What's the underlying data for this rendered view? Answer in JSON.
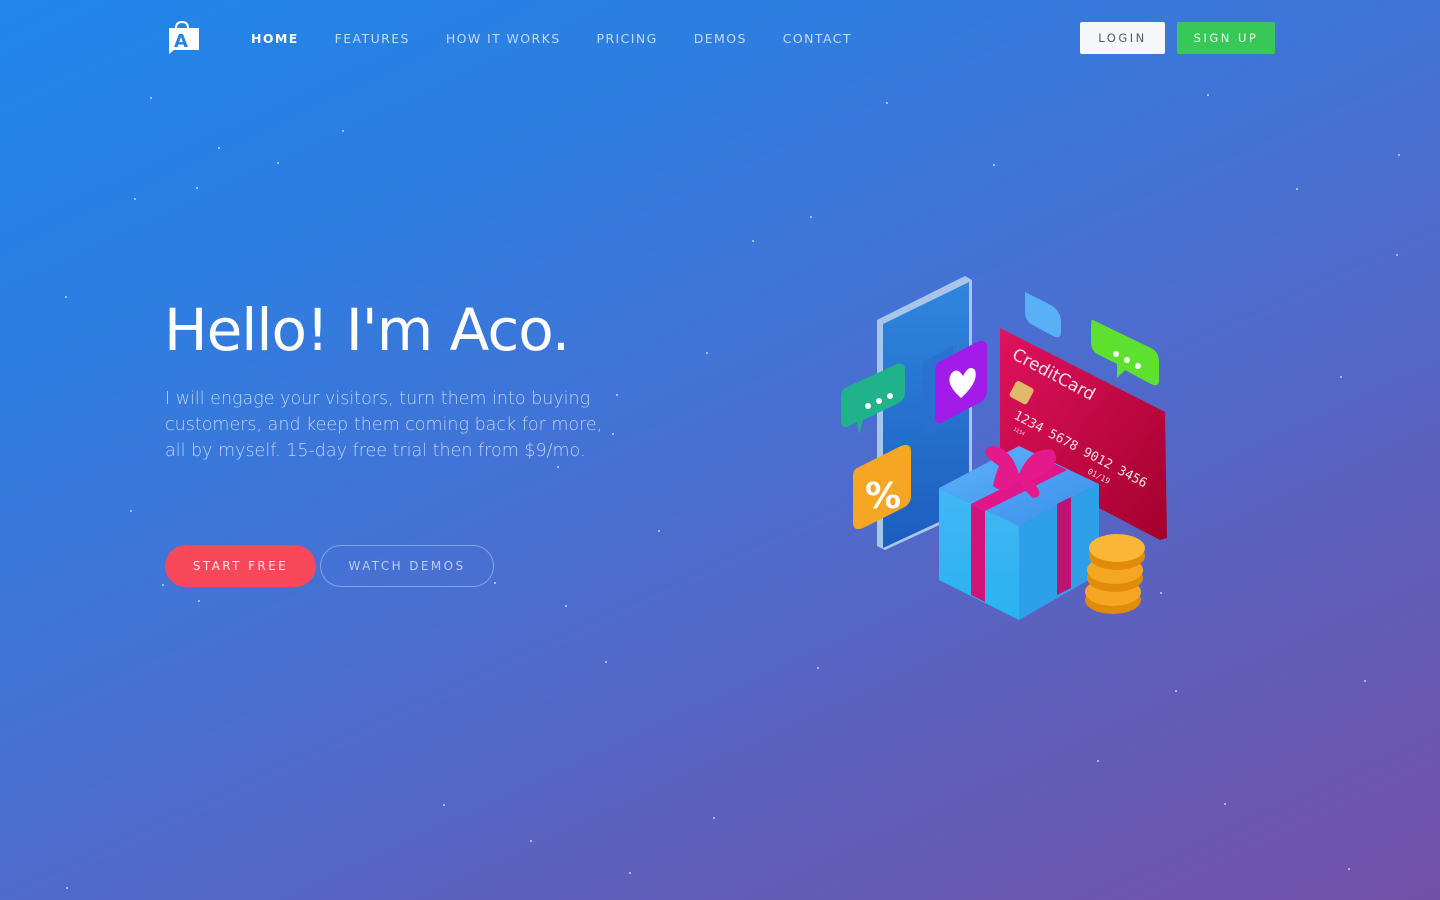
{
  "brand": {
    "logo_letter": "A"
  },
  "nav": {
    "items": [
      {
        "label": "HOME",
        "active": true
      },
      {
        "label": "FEATURES",
        "active": false
      },
      {
        "label": "HOW IT WORKS",
        "active": false
      },
      {
        "label": "PRICING",
        "active": false
      },
      {
        "label": "DEMOS",
        "active": false
      },
      {
        "label": "CONTACT",
        "active": false
      }
    ],
    "login_label": "LOGIN",
    "signup_label": "SIGN UP"
  },
  "hero": {
    "title": "Hello! I'm Aco.",
    "description": "I will engage your visitors, turn them into buying customers, and keep them coming back for more, all by myself. 15-day free trial then from $9/mo.",
    "primary_cta": "START FREE",
    "secondary_cta": "WATCH DEMOS"
  },
  "illustration": {
    "card_brand": "CreditCard",
    "card_number": "1234 5678 9012 3456",
    "card_small": "1234",
    "card_expiry": "01/19",
    "percent_symbol": "%"
  },
  "colors": {
    "signup": "#37c858",
    "start_free": "#f8485a",
    "login_bg": "#f6f7fb"
  }
}
